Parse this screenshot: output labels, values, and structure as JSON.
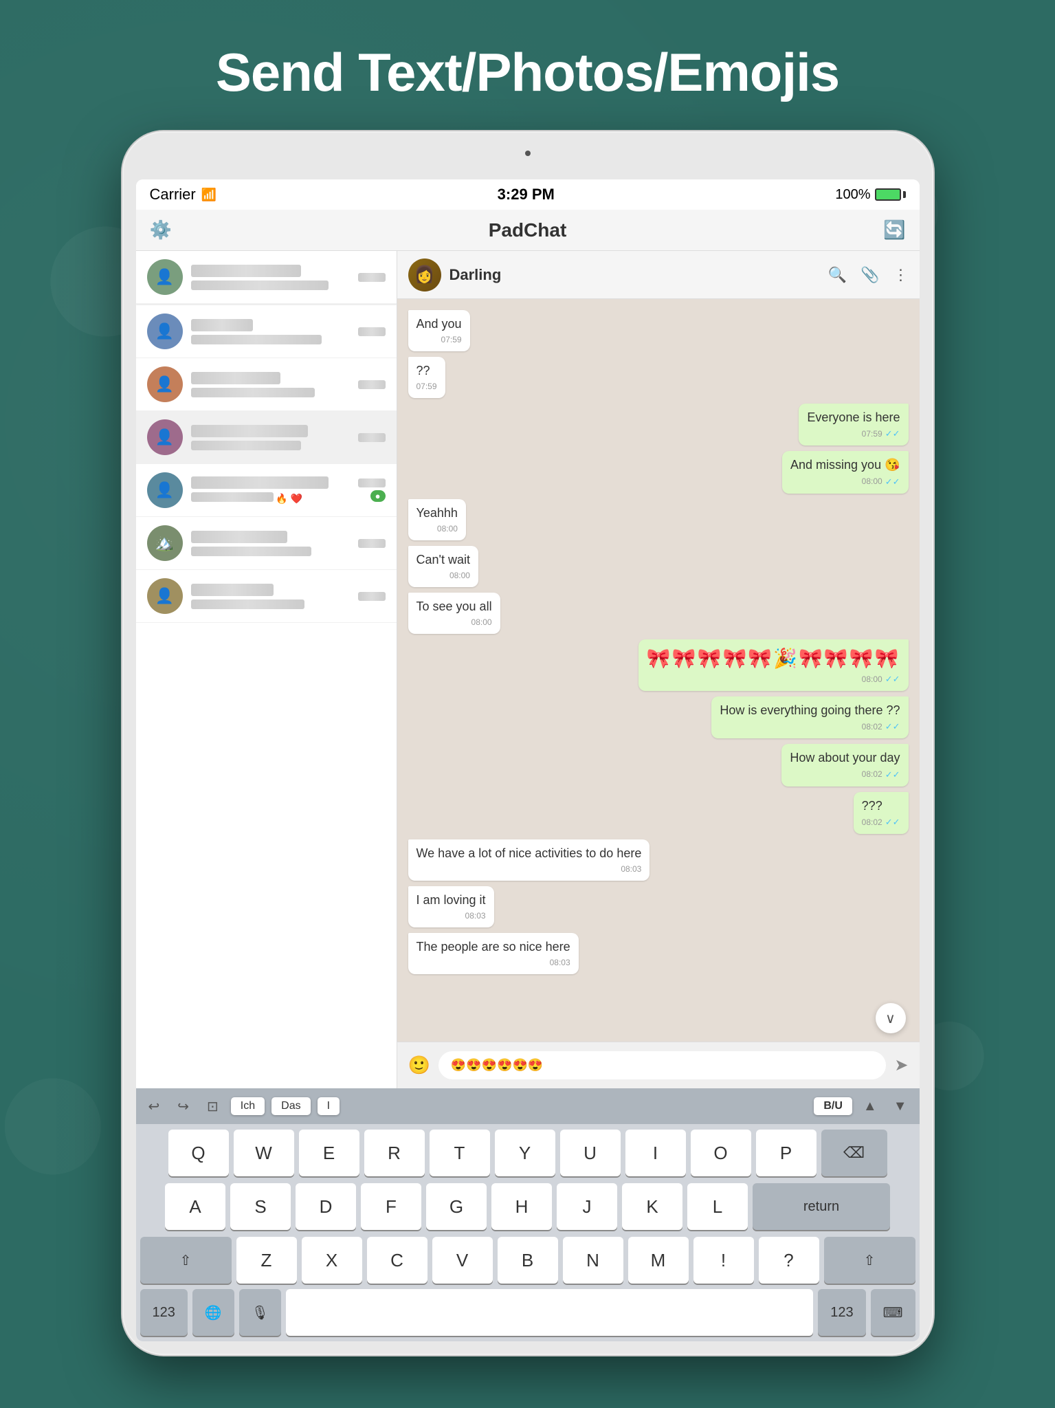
{
  "headline": "Send Text/Photos/Emojis",
  "status_bar": {
    "carrier": "Carrier",
    "time": "3:29 PM",
    "battery": "100%"
  },
  "app_header": {
    "title": "PadChat"
  },
  "chat_contact": {
    "name": "Darling"
  },
  "messages": [
    {
      "id": 1,
      "type": "received",
      "text": "And you",
      "time": "07:59",
      "ticks": ""
    },
    {
      "id": 2,
      "type": "received",
      "text": "??",
      "time": "07:59",
      "ticks": ""
    },
    {
      "id": 3,
      "type": "sent",
      "text": "Everyone is here",
      "time": "07:59",
      "ticks": "✓✓"
    },
    {
      "id": 4,
      "type": "sent",
      "text": "And missing you 😘",
      "time": "08:00",
      "ticks": "✓✓"
    },
    {
      "id": 5,
      "type": "received",
      "text": "Yeahhh",
      "time": "08:00",
      "ticks": ""
    },
    {
      "id": 6,
      "type": "received",
      "text": "Can't wait",
      "time": "08:00",
      "ticks": ""
    },
    {
      "id": 7,
      "type": "received",
      "text": "To see you all",
      "time": "08:00",
      "ticks": ""
    },
    {
      "id": 8,
      "type": "sent",
      "text": "🎀🎀🎀🎀🎀🎉🎀🎀🎀🎀",
      "time": "08:00",
      "ticks": "✓✓"
    },
    {
      "id": 9,
      "type": "sent",
      "text": "How is everything going there ??",
      "time": "08:02",
      "ticks": "✓✓"
    },
    {
      "id": 10,
      "type": "sent",
      "text": "How about your day",
      "time": "08:02",
      "ticks": "✓✓"
    },
    {
      "id": 11,
      "type": "sent",
      "text": "???",
      "time": "08:02",
      "ticks": "✓✓"
    },
    {
      "id": 12,
      "type": "received",
      "text": "We have a lot of nice activities to do here",
      "time": "08:03",
      "ticks": ""
    },
    {
      "id": 13,
      "type": "received",
      "text": "I am loving it",
      "time": "08:03",
      "ticks": ""
    },
    {
      "id": 14,
      "type": "received",
      "text": "The people are so nice here",
      "time": "08:03",
      "ticks": ""
    }
  ],
  "chat_input": {
    "emoji_placeholder": "😍😍😍😍😍😍",
    "placeholder": ""
  },
  "contacts": [
    {
      "id": 1,
      "name": "░░░ ░░░░░░░ ░░░░░░",
      "preview": "░░░░░░ ░░░░░░░░░░░░",
      "time": "░░░░░"
    },
    {
      "id": 2,
      "name": "░░░░░",
      "preview": "░░░░░░ ░░░░░░░░░░░",
      "time": "░░░░░"
    },
    {
      "id": 3,
      "name": "░░░░░░ ░░░░░░",
      "preview": "░░░░ ░░░░░░░░░░░░",
      "time": "░░░░░"
    },
    {
      "id": 4,
      "name": "░░░░░░░░░░░░ ░░░░░░░░",
      "preview": "░░░░░░░░░░░░",
      "time": "░░░░░"
    },
    {
      "id": 5,
      "name": "░░ ░░░░░░░░░░ ░░░░░░",
      "preview": "░░░░░░ ░░░░░ 🔥 ❤",
      "time": "░░░░░"
    },
    {
      "id": 6,
      "name": "░░░ ░░░░░░░",
      "preview": "░░░░░░░░ ░░░░░ ●",
      "time": "░░░░░"
    },
    {
      "id": 7,
      "name": "░ ░░░░░░░░░░",
      "preview": "░░░░░░░░",
      "time": "░░░░░"
    }
  ],
  "keyboard": {
    "toolbar": {
      "undo_label": "↩",
      "redo_label": "↪",
      "copy_label": "⊡",
      "suggestion1": "Ich",
      "suggestion2": "Das",
      "suggestion3": "I",
      "bold_label": "B/U",
      "up_label": "▲",
      "down_label": "▼"
    },
    "rows": [
      [
        "Q",
        "W",
        "E",
        "R",
        "T",
        "Y",
        "U",
        "I",
        "O",
        "P"
      ],
      [
        "A",
        "S",
        "D",
        "F",
        "G",
        "H",
        "J",
        "K",
        "L"
      ],
      [
        "⇧",
        "Z",
        "X",
        "C",
        "V",
        "B",
        "N",
        "M",
        "!",
        "?",
        "⇧"
      ],
      [
        "123",
        "🌐",
        "🎙",
        "",
        "",
        "",
        "",
        "",
        "",
        "",
        "123",
        "⌨"
      ]
    ],
    "delete_label": "⌫",
    "return_label": "return",
    "space_label": ""
  }
}
